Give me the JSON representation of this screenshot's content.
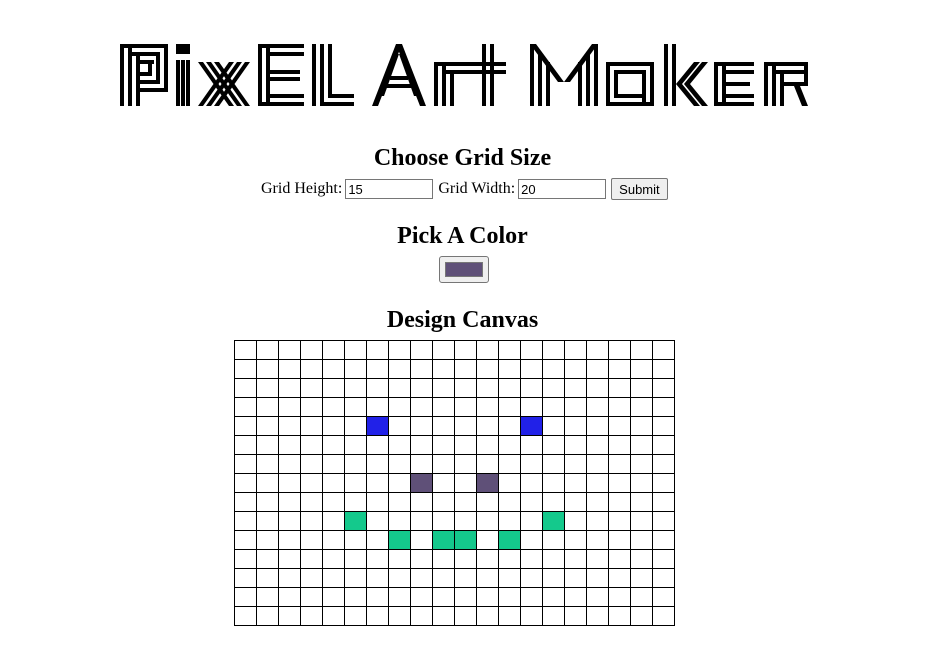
{
  "header": {
    "title": "Pixel Art Maker"
  },
  "grid_size": {
    "heading": "Choose Grid Size",
    "height_label": "Grid Height:",
    "height_value": "15",
    "width_label": "Grid Width:",
    "width_value": "20",
    "submit_label": "Submit"
  },
  "color": {
    "heading": "Pick A Color",
    "selected": "#5f5078"
  },
  "canvas": {
    "heading": "Design Canvas",
    "rows": 15,
    "cols": 20,
    "cells": [
      {
        "row": 4,
        "col": 6,
        "color": "#2121e8"
      },
      {
        "row": 4,
        "col": 13,
        "color": "#2121e8"
      },
      {
        "row": 7,
        "col": 8,
        "color": "#5f5078"
      },
      {
        "row": 7,
        "col": 11,
        "color": "#5f5078"
      },
      {
        "row": 9,
        "col": 5,
        "color": "#14c98c"
      },
      {
        "row": 9,
        "col": 14,
        "color": "#14c98c"
      },
      {
        "row": 10,
        "col": 7,
        "color": "#14c98c"
      },
      {
        "row": 10,
        "col": 9,
        "color": "#14c98c"
      },
      {
        "row": 10,
        "col": 10,
        "color": "#14c98c"
      },
      {
        "row": 10,
        "col": 12,
        "color": "#14c98c"
      }
    ]
  }
}
